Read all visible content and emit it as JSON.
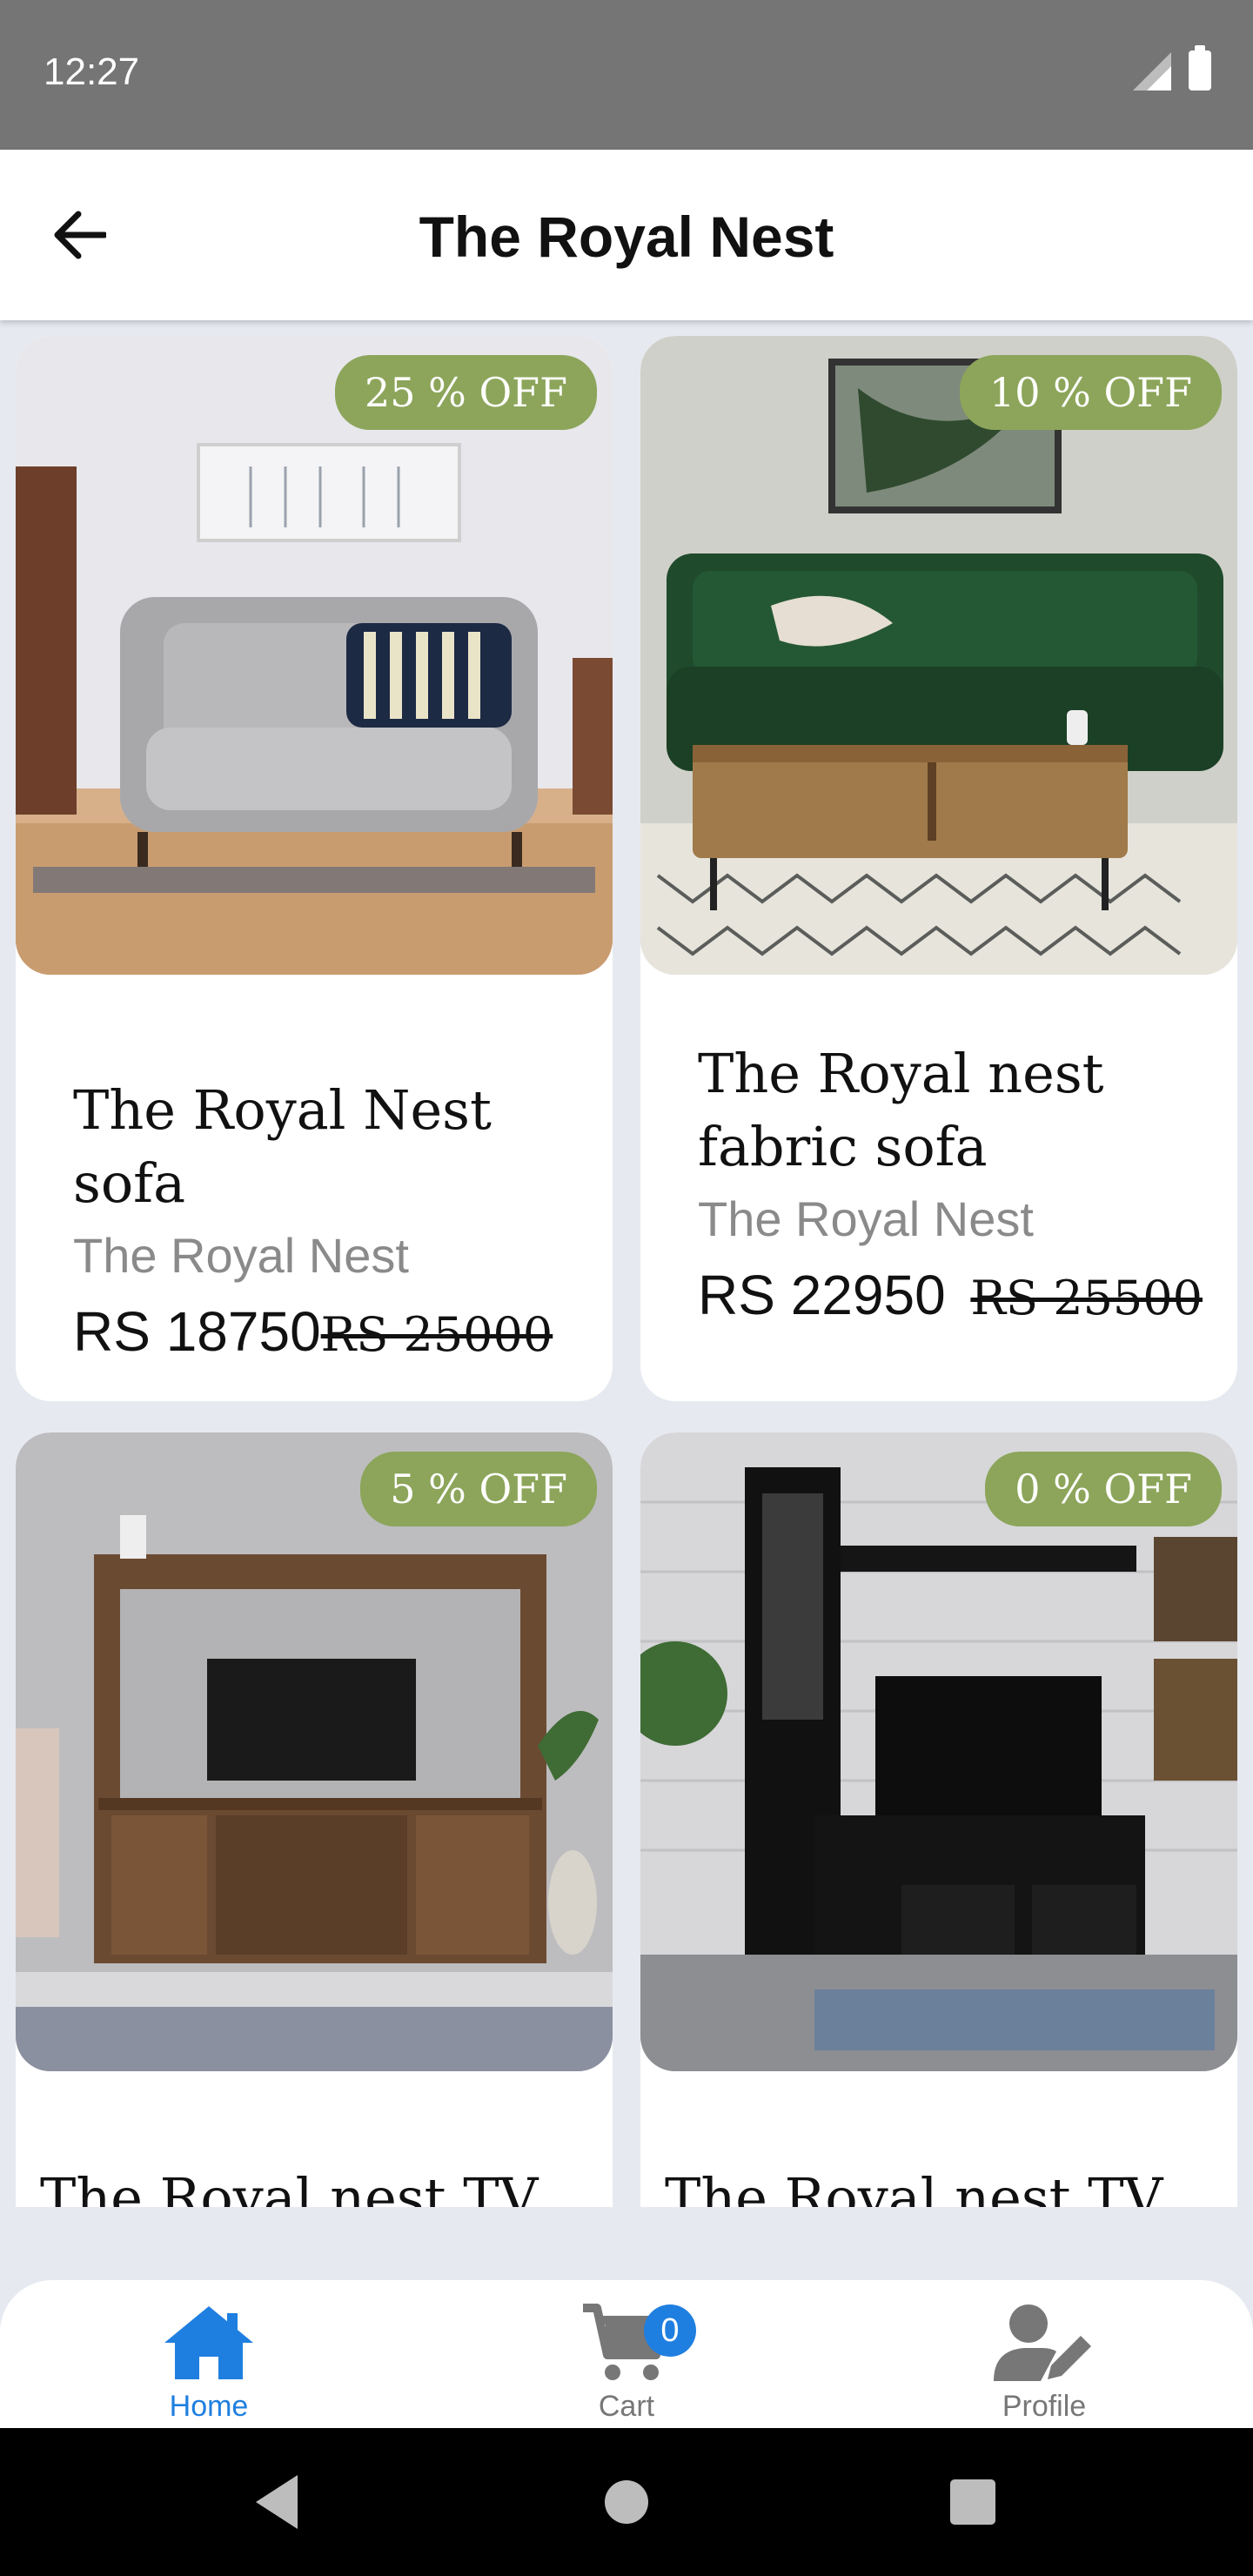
{
  "status_bar": {
    "time": "12:27"
  },
  "app_bar": {
    "title": "The Royal Nest",
    "back_icon": "arrow-left-icon"
  },
  "products": [
    {
      "discount": "25 % OFF",
      "name": "The Royal Nest sofa",
      "brand": "The Royal Nest",
      "price": "RS 18750",
      "old_price": "RS 25000"
    },
    {
      "discount": "10 % OFF",
      "name": "The Royal nest fabric sofa",
      "brand": "The Royal Nest",
      "price": "RS 22950",
      "old_price": "RS 25500"
    },
    {
      "discount": "5 % OFF",
      "name": "The Royal nest TV unit",
      "brand": "",
      "price": "",
      "old_price": ""
    },
    {
      "discount": "0 % OFF",
      "name": "The Royal nest TV unit",
      "brand": "",
      "price": "",
      "old_price": ""
    }
  ],
  "bottom_nav": {
    "items": [
      {
        "label": "Home",
        "icon": "home-icon",
        "active": true
      },
      {
        "label": "Cart",
        "icon": "cart-icon",
        "badge": "0"
      },
      {
        "label": "Profile",
        "icon": "user-edit-icon"
      }
    ],
    "active_color": "#1f7fe0",
    "inactive_color": "#777777"
  },
  "colors": {
    "discount_badge": "#8ca55a",
    "background": "#e6e9f0"
  }
}
